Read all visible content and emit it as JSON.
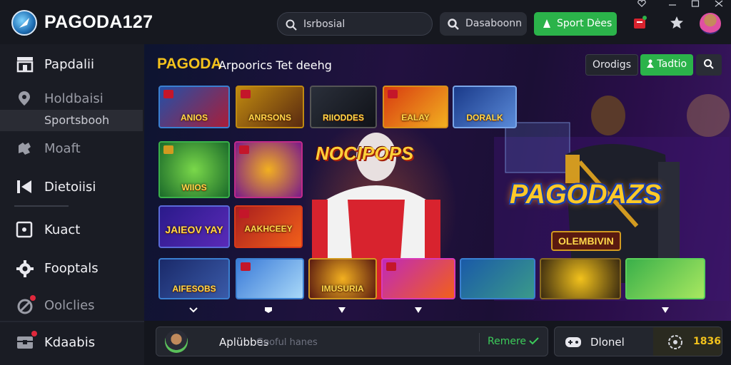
{
  "header": {
    "brand": "PAGODA127",
    "search_text": "Isrbosial",
    "search2_text": "Dasaboonn",
    "sport_button": "Sport Dėes"
  },
  "sidebar": {
    "items": [
      {
        "label": "Papdalii"
      },
      {
        "label": "Holdbaisi"
      },
      {
        "label": "Sportsbooh"
      },
      {
        "label": "Moaft"
      },
      {
        "label": "Dietoiisi"
      },
      {
        "label": "Kuact"
      },
      {
        "label": "Fooptals"
      },
      {
        "label": "Oolclies"
      },
      {
        "label": "Kdaabis"
      }
    ]
  },
  "main": {
    "promo_title": "PAGODA",
    "promo_sub": "Arpoorics Tet deehg",
    "chips": {
      "c1": "Orodigs",
      "c2": "Tadtio"
    },
    "games_row1": [
      "ANIOS",
      "ANRSONS",
      "RIIODDES",
      "EALAY",
      "DORALK"
    ],
    "games_row2": [
      "WIIOS",
      ""
    ],
    "games_row3": [
      "JAIEOV YAY",
      "AAKHCEEY"
    ],
    "games_row4": [
      "AIFESOBS",
      "",
      "IMUSURIA",
      "",
      "",
      "",
      ""
    ],
    "banner_text_1": "NOCIPOPS",
    "banner_text_2": "PAGODAZS",
    "banner_badge": "OLEMBIVIN"
  },
  "bottom": {
    "name": "Aplübbes",
    "hint": "Geoful hanes",
    "remark": "Remere",
    "box_label": "Dlonel",
    "box_value": "1836"
  },
  "colors": {
    "accent_green": "#2bb34a",
    "brand_gold": "#f4c21c"
  }
}
